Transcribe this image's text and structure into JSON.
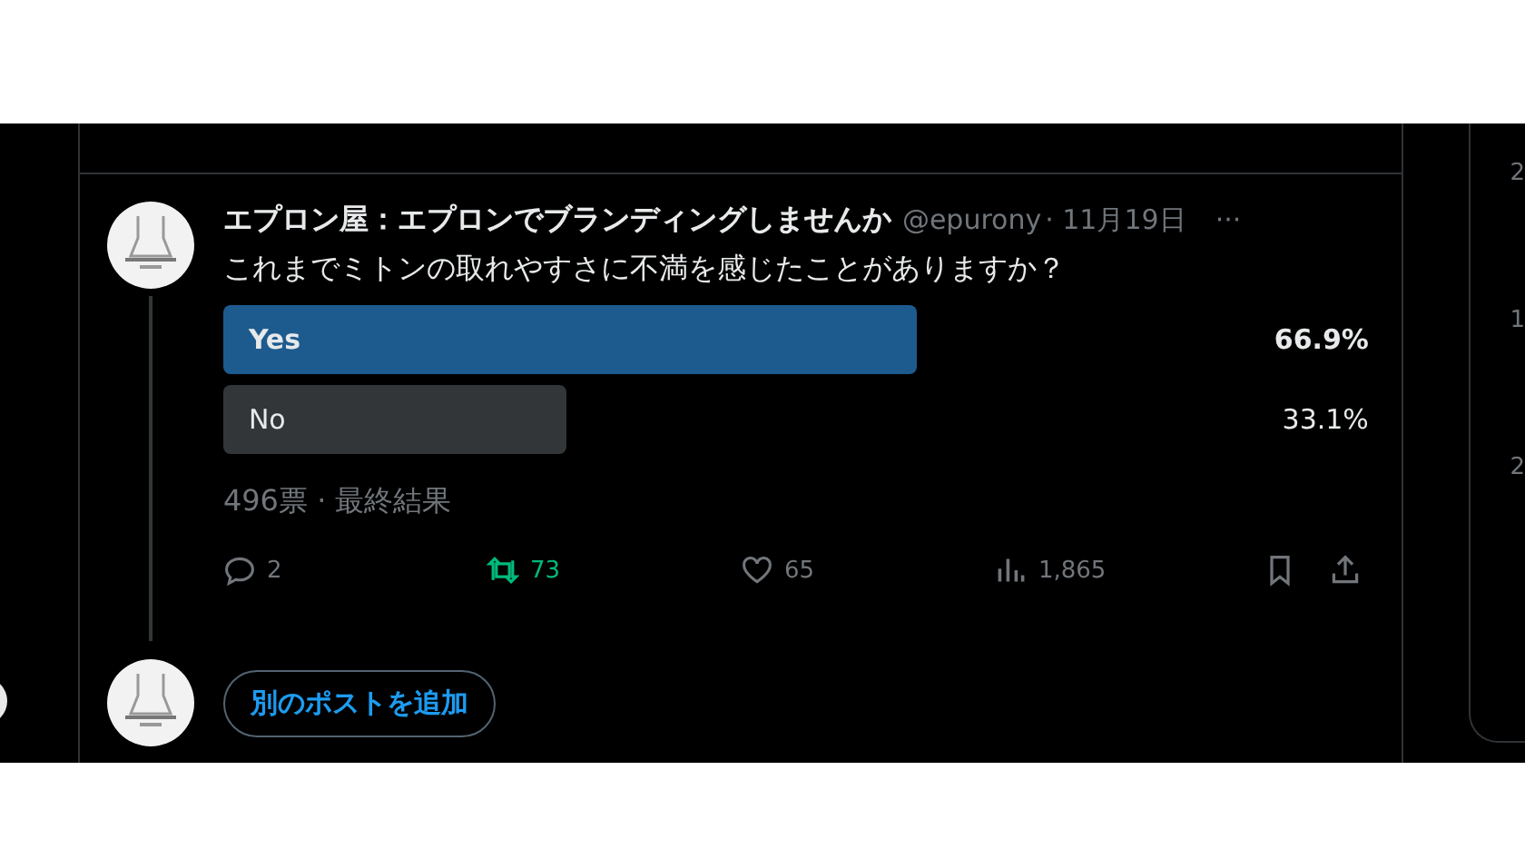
{
  "post": {
    "display_name": "エプロン屋：エプロンでブランディングしませんか",
    "handle": "@epurony",
    "time": "· 11月19日",
    "more": "···",
    "text": "これまでミトンの取れやすさに不満を感じたことがありますか？",
    "poll": {
      "options": [
        {
          "label": "Yes",
          "percent": "66.9%",
          "selected": true
        },
        {
          "label": "No",
          "percent": "33.1%",
          "selected": false
        }
      ],
      "summary": "496票 · 最終結果"
    },
    "actions": [
      {
        "kind": "reply",
        "count": "2",
        "active": false
      },
      {
        "kind": "repost",
        "count": "73",
        "active": true
      },
      {
        "kind": "like",
        "count": "65",
        "active": false
      },
      {
        "kind": "views",
        "count": "1,865",
        "active": false
      },
      {
        "kind": "bookmark",
        "active": false
      },
      {
        "kind": "share",
        "active": false
      }
    ]
  },
  "add_post_button": "別のポストを追加",
  "sidebar": {
    "items": [
      {
        "meta": "2"
      },
      {
        "meta": "1"
      },
      {
        "meta": "2"
      }
    ]
  }
}
